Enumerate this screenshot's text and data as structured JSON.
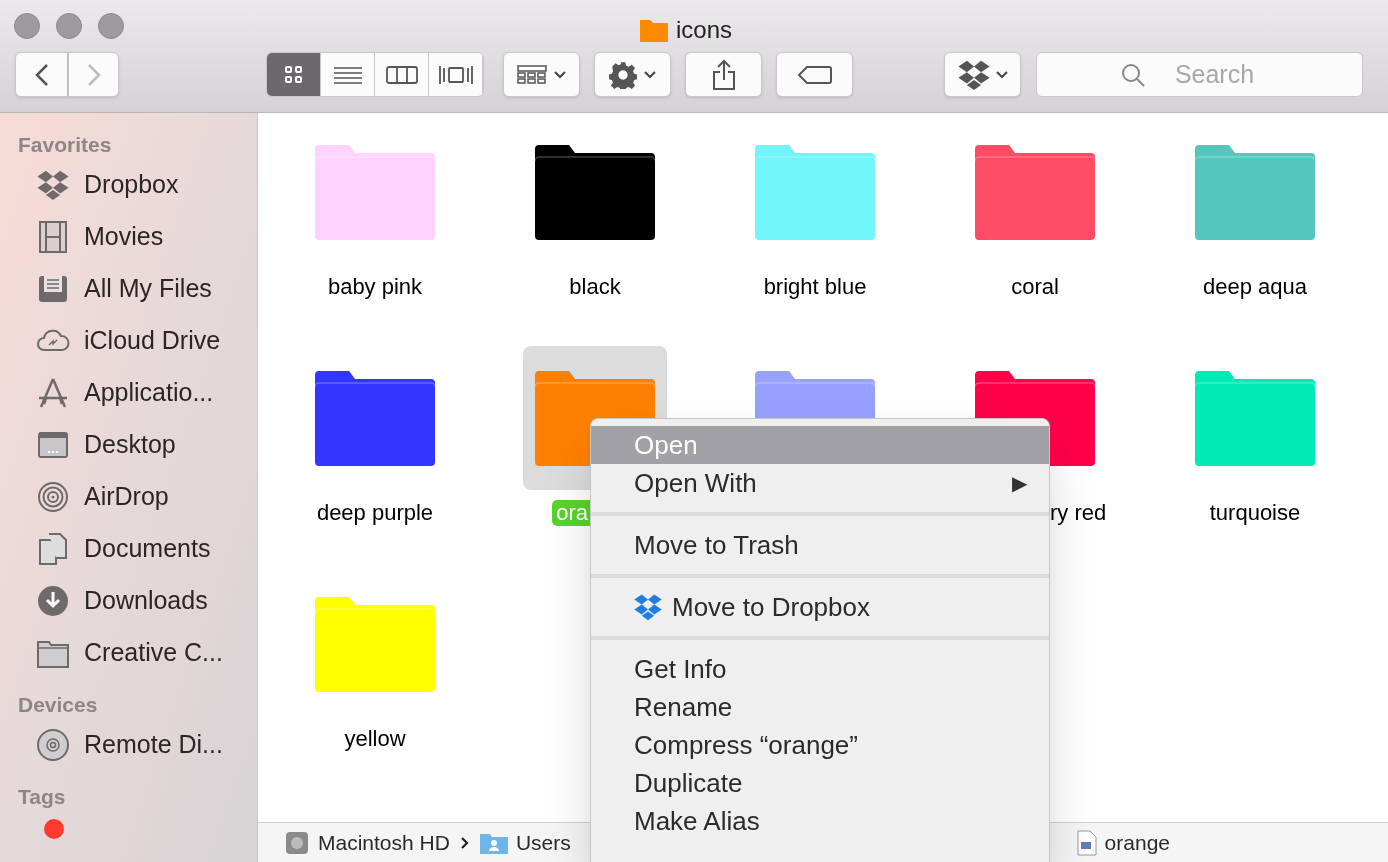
{
  "window": {
    "title": "icons"
  },
  "toolbar": {
    "back": {
      "disabled": false
    },
    "forward": {
      "disabled": true
    },
    "view_modes": [
      {
        "kind": "icons",
        "selected": true
      },
      {
        "kind": "list",
        "selected": false
      },
      {
        "kind": "columns",
        "selected": false
      },
      {
        "kind": "cover",
        "selected": false
      }
    ],
    "search": {
      "placeholder": "Search"
    }
  },
  "sidebar": {
    "sections": [
      {
        "title": "Favorites",
        "items": [
          {
            "kind": "dropbox",
            "label": "Dropbox"
          },
          {
            "kind": "movies",
            "label": "Movies"
          },
          {
            "kind": "allfiles",
            "label": "All My Files"
          },
          {
            "kind": "cloud",
            "label": "iCloud Drive"
          },
          {
            "kind": "apps",
            "label": "Applicatio..."
          },
          {
            "kind": "desktop",
            "label": "Desktop"
          },
          {
            "kind": "airdrop",
            "label": "AirDrop"
          },
          {
            "kind": "documents",
            "label": "Documents"
          },
          {
            "kind": "downloads",
            "label": "Downloads"
          },
          {
            "kind": "folder",
            "label": "Creative C..."
          }
        ]
      },
      {
        "title": "Devices",
        "items": [
          {
            "kind": "disc",
            "label": "Remote Di..."
          }
        ]
      },
      {
        "title": "Tags",
        "items": [
          {
            "kind": "tag",
            "color": "#ff3b30"
          }
        ]
      }
    ]
  },
  "folders": [
    {
      "label": "baby pink",
      "color": "#ffd2ff",
      "selected": false
    },
    {
      "label": "black",
      "color": "#000000",
      "selected": false
    },
    {
      "label": "bright blue",
      "color": "#72f4fb",
      "selected": false
    },
    {
      "label": "coral",
      "color": "#ff4b63",
      "selected": false
    },
    {
      "label": "deep aqua",
      "color": "#55c6bd",
      "selected": false
    },
    {
      "label": "deep purple",
      "color": "#3236ff",
      "selected": false
    },
    {
      "label": "ora",
      "color": "#ff8000",
      "selected": true,
      "clipped_right": true
    },
    {
      "color": "#97a1ff",
      "selected": false
    },
    {
      "label": "ry red",
      "color": "#ff0049",
      "selected": false,
      "clipped_left": true
    },
    {
      "label": "turquoise",
      "color": "#00eab7",
      "selected": false
    },
    {
      "label": "yellow",
      "color": "#ffff00",
      "selected": false
    }
  ],
  "path_bar": [
    {
      "kind": "disk",
      "label": "Macintosh HD"
    },
    {
      "kind": "users",
      "label": "Users"
    },
    {
      "kind": "file",
      "label": "orange"
    }
  ],
  "context_menu": [
    {
      "kind": "item",
      "label": "Open",
      "highlighted": true
    },
    {
      "kind": "submenu",
      "label": "Open With",
      "arrow": "▶",
      "highlighted": false
    },
    {
      "kind": "separator"
    },
    {
      "kind": "item",
      "label": "Move to Trash",
      "highlighted": false
    },
    {
      "kind": "separator"
    },
    {
      "kind": "dropbox",
      "label": "Move to Dropbox",
      "highlighted": false
    },
    {
      "kind": "separator"
    },
    {
      "kind": "item",
      "label": "Get Info",
      "highlighted": false
    },
    {
      "kind": "item",
      "label": "Rename",
      "highlighted": false
    },
    {
      "kind": "item",
      "label": "Compress “orange”",
      "highlighted": false
    },
    {
      "kind": "item",
      "label": "Duplicate",
      "highlighted": false
    },
    {
      "kind": "item",
      "label": "Make Alias",
      "highlighted": false
    }
  ]
}
